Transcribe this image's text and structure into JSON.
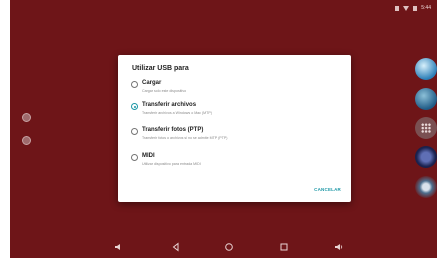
{
  "status_bar": {
    "time": "5:44"
  },
  "dialog": {
    "title": "Utilizar USB para",
    "options": [
      {
        "label": "Cargar",
        "description": "Cargar solo este dispositivo",
        "selected": false
      },
      {
        "label": "Transferir archivos",
        "description": "Transferir archivos a Windows o Mac (MTP)",
        "selected": true
      },
      {
        "label": "Transferir fotos (PTP)",
        "description": "Transferir fotos o archivos si no se admite MTP (PTP)",
        "selected": false
      },
      {
        "label": "MIDI",
        "description": "Utilizar dispositivo para entrada MIDI",
        "selected": false
      }
    ],
    "cancel_label": "CANCELAR"
  },
  "navigation": {
    "volume_down_icon": "volume-down-icon",
    "back_icon": "back-icon",
    "home_icon": "home-icon",
    "recents_icon": "recents-icon",
    "volume_up_icon": "volume-up-icon"
  },
  "colors": {
    "wallpaper": "#6e1518",
    "accent": "#1c97a6",
    "dialog_bg": "#ffffff"
  }
}
